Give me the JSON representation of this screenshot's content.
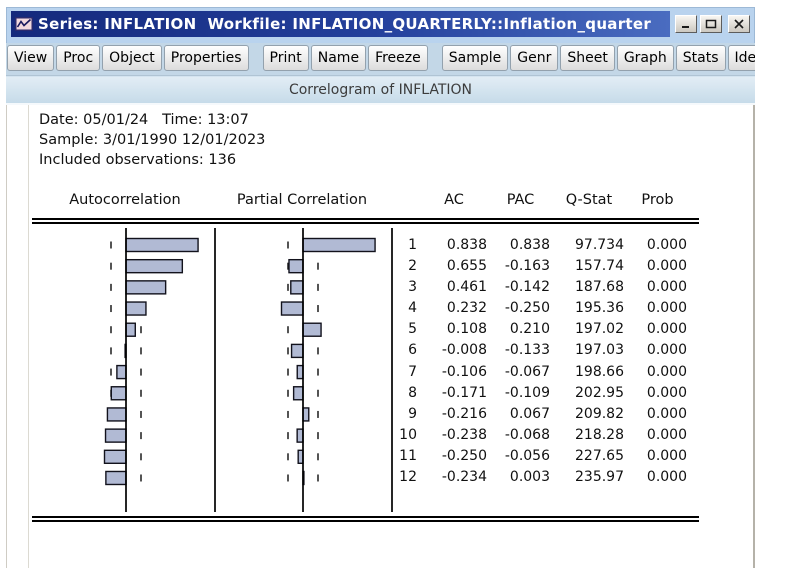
{
  "window": {
    "title": "Series: INFLATION  Workfile: INFLATION_QUARTERLY::Inflation_quarter"
  },
  "icons": {
    "titlebar": "series-chart-icon",
    "minimize": "minimize-icon",
    "maximize": "maximize-icon",
    "close": "close-icon"
  },
  "toolbar": {
    "buttons": [
      {
        "label": "View"
      },
      {
        "label": "Proc"
      },
      {
        "label": "Object"
      },
      {
        "label": "Properties"
      },
      {
        "label": "Print",
        "group_start": true
      },
      {
        "label": "Name"
      },
      {
        "label": "Freeze"
      },
      {
        "label": "Sample",
        "group_start": true
      },
      {
        "label": "Genr"
      },
      {
        "label": "Sheet"
      },
      {
        "label": "Graph"
      },
      {
        "label": "Stats"
      },
      {
        "label": "Ide"
      }
    ]
  },
  "view_header": {
    "title": "Correlogram of INFLATION"
  },
  "info": {
    "date_line": "Date: 05/01/24   Time: 13:07",
    "sample_line": "Sample: 3/01/1990 12/01/2023",
    "observations_line": "Included observations: 136"
  },
  "table": {
    "headers": {
      "autocorrelation": "Autocorrelation",
      "partial_correlation": "Partial Correlation",
      "lag": "",
      "ac": "AC",
      "pac": "PAC",
      "qstat": "Q-Stat",
      "prob": "Prob"
    }
  },
  "chart_data": {
    "type": "bar",
    "orientation": "horizontal",
    "title": "Correlogram of INFLATION",
    "approx_confidence_bound": 0.171,
    "axis": {
      "zero_line": true,
      "dashed_bounds": true
    },
    "series": [
      {
        "name": "Autocorrelation",
        "values": [
          0.838,
          0.655,
          0.461,
          0.232,
          0.108,
          -0.008,
          -0.106,
          -0.171,
          -0.216,
          -0.238,
          -0.25,
          -0.234
        ]
      },
      {
        "name": "Partial Correlation",
        "values": [
          0.838,
          -0.163,
          -0.142,
          -0.25,
          0.21,
          -0.133,
          -0.067,
          -0.109,
          0.067,
          -0.068,
          -0.056,
          0.003
        ]
      }
    ],
    "rows": [
      {
        "lag": "1",
        "ac": "0.838",
        "pac": "0.838",
        "qstat": "97.734",
        "prob": "0.000"
      },
      {
        "lag": "2",
        "ac": "0.655",
        "pac": "-0.163",
        "qstat": "157.74",
        "prob": "0.000"
      },
      {
        "lag": "3",
        "ac": "0.461",
        "pac": "-0.142",
        "qstat": "187.68",
        "prob": "0.000"
      },
      {
        "lag": "4",
        "ac": "0.232",
        "pac": "-0.250",
        "qstat": "195.36",
        "prob": "0.000"
      },
      {
        "lag": "5",
        "ac": "0.108",
        "pac": "0.210",
        "qstat": "197.02",
        "prob": "0.000"
      },
      {
        "lag": "6",
        "ac": "-0.008",
        "pac": "-0.133",
        "qstat": "197.03",
        "prob": "0.000"
      },
      {
        "lag": "7",
        "ac": "-0.106",
        "pac": "-0.067",
        "qstat": "198.66",
        "prob": "0.000"
      },
      {
        "lag": "8",
        "ac": "-0.171",
        "pac": "-0.109",
        "qstat": "202.95",
        "prob": "0.000"
      },
      {
        "lag": "9",
        "ac": "-0.216",
        "pac": "0.067",
        "qstat": "209.82",
        "prob": "0.000"
      },
      {
        "lag": "10",
        "ac": "-0.238",
        "pac": "-0.068",
        "qstat": "218.28",
        "prob": "0.000"
      },
      {
        "lag": "11",
        "ac": "-0.250",
        "pac": "-0.056",
        "qstat": "227.65",
        "prob": "0.000"
      },
      {
        "lag": "12",
        "ac": "-0.234",
        "pac": "0.003",
        "qstat": "235.97",
        "prob": "0.000"
      }
    ]
  },
  "colors": {
    "bar_fill": "#b1bad4",
    "bar_border": "#12121c",
    "titlebar_left": "#14297c",
    "titlebar_right": "#4a6cc0",
    "chrome_blue": "#b9d3ee",
    "toolbar_bg": "#c3d7e7",
    "header_band": "#cfe0ec"
  }
}
